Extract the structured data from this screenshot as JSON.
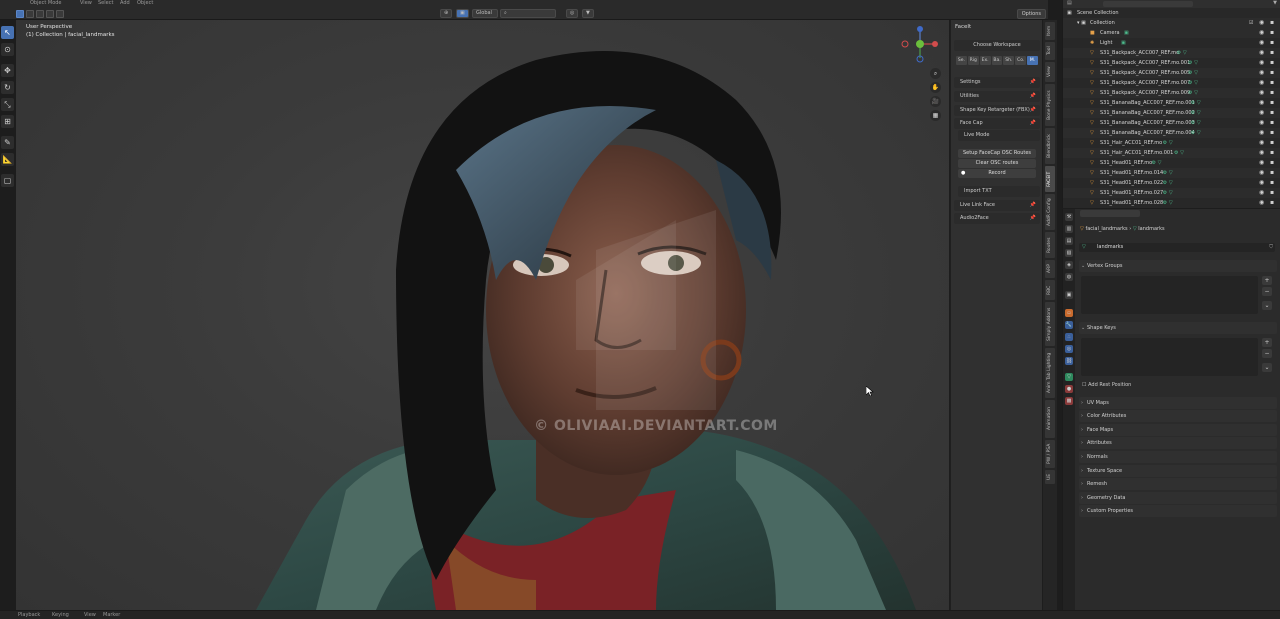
{
  "topbar": {
    "mode": "Object Mode",
    "menus": [
      "View",
      "Select",
      "Add",
      "Object"
    ],
    "orientation": "Global",
    "options": "Options"
  },
  "viewport": {
    "perspective": "User Perspective",
    "collection_info": "(1) Collection | facial_landmarks",
    "watermark": "© OLIVIAAI.DEVIANTART.COM"
  },
  "npanel": {
    "title": "FaceIt",
    "choose_workspace": "Choose Workspace",
    "tabs": [
      "Se.",
      "Rig",
      "Ex.",
      "Ba.",
      "Sh.",
      "Co.",
      "M."
    ],
    "settings": "Settings",
    "utilities": "Utilities",
    "shape_key_retargeter": "Shape Key Retargeter (FBX)",
    "face_cap": "Face Cap",
    "live_mode": "Live Mode",
    "setup_osc": "Setup FaceCap OSC Routes",
    "clear_osc": "Clear OSC routes",
    "record": "Record",
    "import_txt": "Import TXT",
    "live_link_face": "Live Link Face",
    "audio2face": "Audio2Face"
  },
  "vtabs": [
    "Item",
    "Tool",
    "View",
    "Bone Physics",
    "Blendbrick",
    "FACEIT",
    "AddR Config",
    "Routes",
    "ARP",
    "RBC",
    "Simply Addons",
    "Anim Tab Lighting",
    "Animation",
    "PW / PSA",
    "UE"
  ],
  "outliner": {
    "title": "Scene Collection",
    "collection": "Collection",
    "items": [
      {
        "name": "Camera",
        "type": "camera"
      },
      {
        "name": "Light",
        "type": "light"
      },
      {
        "name": "S31_Backpack_ACC007_REF.mo",
        "type": "mesh"
      },
      {
        "name": "S31_Backpack_ACC007_REF.mo.001",
        "type": "mesh"
      },
      {
        "name": "S31_Backpack_ACC007_REF.mo.005",
        "type": "mesh"
      },
      {
        "name": "S31_Backpack_ACC007_REF.mo.007",
        "type": "mesh"
      },
      {
        "name": "S31_Backpack_ACC007_REF.mo.009",
        "type": "mesh"
      },
      {
        "name": "S31_BananaBag_ACC007_REF.mo.001",
        "type": "mesh"
      },
      {
        "name": "S31_BananaBag_ACC007_REF.mo.002",
        "type": "mesh"
      },
      {
        "name": "S31_BananaBag_ACC007_REF.mo.003",
        "type": "mesh"
      },
      {
        "name": "S31_BananaBag_ACC007_REF.mo.004",
        "type": "mesh"
      },
      {
        "name": "S31_Hair_ACC01_REF.mo",
        "type": "mesh"
      },
      {
        "name": "S31_Hair_ACC01_REF.mo.001",
        "type": "mesh"
      },
      {
        "name": "S31_Head01_REF.mo",
        "type": "mesh"
      },
      {
        "name": "S31_Head01_REF.mo.014",
        "type": "mesh"
      },
      {
        "name": "S31_Head01_REF.mo.022",
        "type": "mesh"
      },
      {
        "name": "S31_Head01_REF.mo.027",
        "type": "mesh"
      },
      {
        "name": "S31_Head01_REF.mo.028",
        "type": "mesh"
      }
    ]
  },
  "properties": {
    "breadcrumb_object": "facial_landmarks",
    "breadcrumb_data": "landmarks",
    "data_name": "landmarks",
    "vertex_groups": "Vertex Groups",
    "shape_keys": "Shape Keys",
    "add_rest_position": "Add Rest Position",
    "sections": [
      "UV Maps",
      "Color Attributes",
      "Face Maps",
      "Attributes",
      "Normals",
      "Texture Space",
      "Remesh",
      "Geometry Data",
      "Custom Properties"
    ]
  },
  "bottombar": [
    "Playback",
    "Keying",
    "View",
    "Marker"
  ],
  "colors": {
    "accent": "#4772b3",
    "mesh_icon": "#e49a3a",
    "modifier_icon": "#4dbf8f"
  }
}
